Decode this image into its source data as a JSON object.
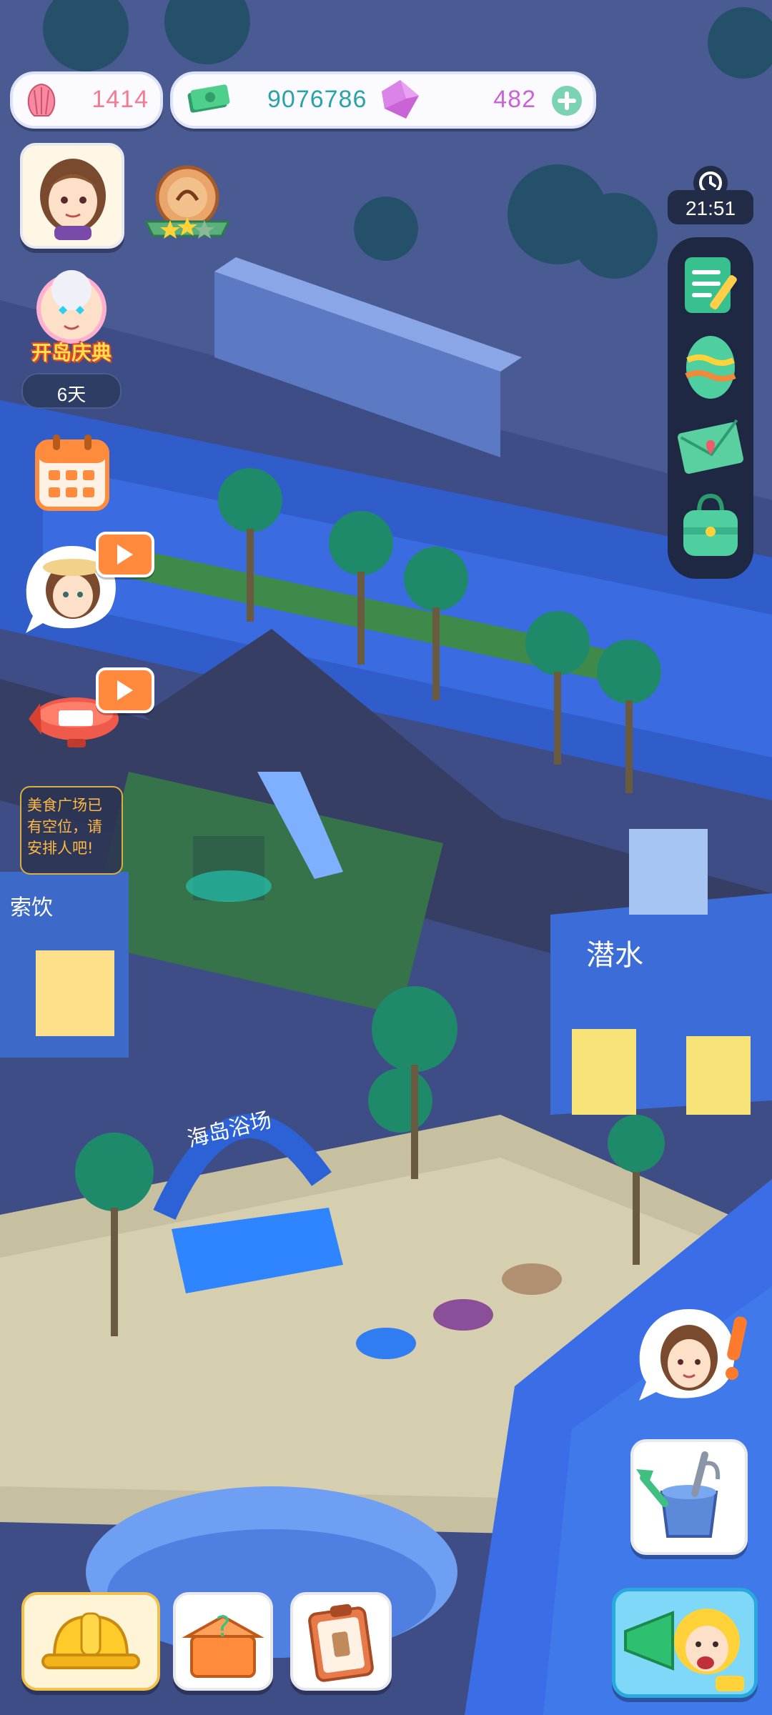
{
  "currencies": {
    "shells": "1414",
    "cash": "9076786",
    "gems": "482"
  },
  "clock": {
    "time": "21:51"
  },
  "event": {
    "name": "开岛庆典",
    "days_left": "6天"
  },
  "notice": {
    "text": "美食广场已有空位，请安排人吧!"
  },
  "buildings": {
    "beach": "海岛浴场",
    "diving": "潜水",
    "shop": "索饮"
  },
  "colors": {
    "shell_pink": "#f47b92",
    "cash_teal": "#2aa3a8",
    "gem_purple": "#c864d6",
    "ocean": "#3d6ee0",
    "road": "#3a4368"
  },
  "icons": {
    "shell": "shell-icon",
    "cash": "cash-icon",
    "gem": "gem-icon",
    "add": "plus-icon",
    "clock": "clock-icon",
    "tasks": "notepad-icon",
    "egg": "easter-egg-icon",
    "mail": "envelope-icon",
    "bag": "bag-icon",
    "build": "hardhat-icon",
    "mystery": "mystery-box-icon",
    "orders": "clipboard-icon",
    "watering": "watering-can-icon",
    "megaphone": "megaphone-icon",
    "calendar": "calendar-icon"
  }
}
